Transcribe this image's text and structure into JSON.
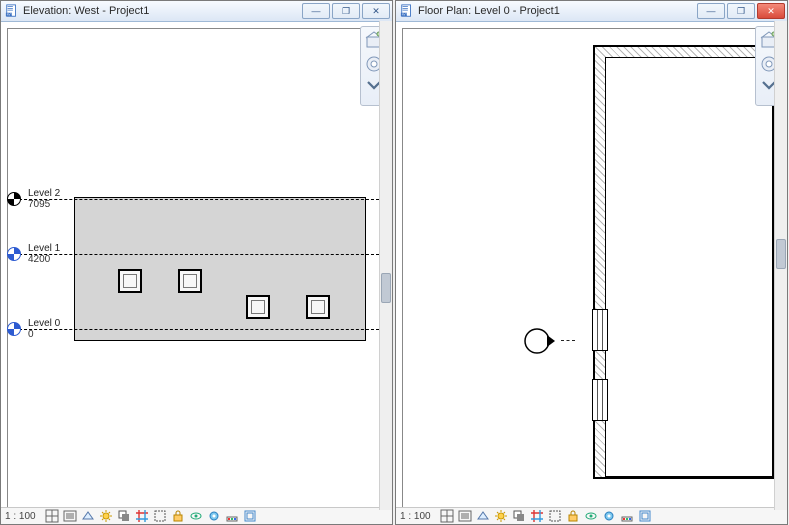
{
  "panels": {
    "elevation": {
      "title": "Elevation: West - Project1",
      "scale": "1 : 100",
      "levels": [
        {
          "name": "Level 2",
          "value": "7095",
          "color": "#000000"
        },
        {
          "name": "Level 1",
          "value": "4200",
          "color": "#2d5bd1"
        },
        {
          "name": "Level 0",
          "value": "0",
          "color": "#2d5bd1"
        }
      ]
    },
    "floorplan": {
      "title": "Floor Plan: Level 0 - Project1",
      "scale": "1 : 100"
    }
  },
  "window_buttons": {
    "minimize": "—",
    "restore": "❐",
    "close": "✕"
  },
  "icons": {
    "document": "doc",
    "nav_home": "home",
    "nav_wheel": "wheel"
  }
}
